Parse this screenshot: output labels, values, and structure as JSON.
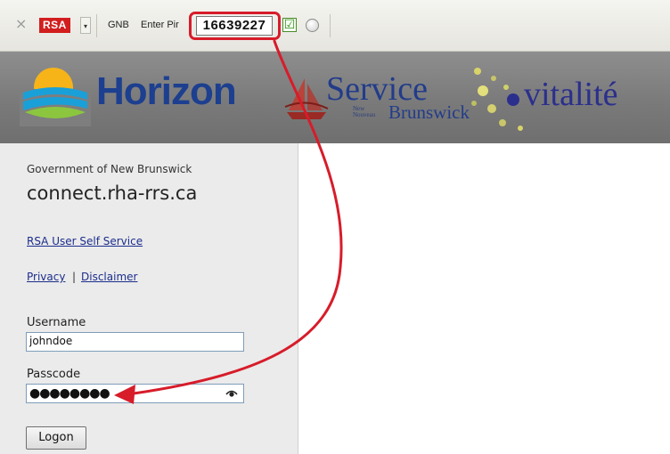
{
  "toolbar": {
    "close_glyph": "×",
    "rsa_label": "RSA",
    "dropdown_glyph": "▾",
    "gnb_label": "GNB",
    "pin_label": "Enter Pir",
    "token_code": "16639227",
    "check_glyph": "☑"
  },
  "banner": {
    "horizon_name": "Horizon",
    "service_word": "Service",
    "new_label": "New\nNouveau",
    "brunswick_word": "Brunswick",
    "vitalite_word": "vitalité"
  },
  "login": {
    "gov_label": "Government of New Brunswick",
    "site_title": "connect.rha-rrs.ca",
    "self_service_link": "RSA User Self Service",
    "privacy_link": "Privacy",
    "separator": "|",
    "disclaimer_link": "Disclaimer",
    "username_label": "Username",
    "username_value": "johndoe",
    "passcode_label": "Passcode",
    "passcode_masked": "●●●●●●●●",
    "logon_label": "Logon"
  },
  "colors": {
    "annotation_red": "#d71c2a",
    "rsa_red": "#d21e1e",
    "horizon_blue": "#1d3f8f",
    "link_blue": "#1b2d8c",
    "banner_gray": "#7e7e7e"
  },
  "icons": {
    "close": "close-icon",
    "check": "checkbox-checked-icon",
    "status": "status-circle-icon",
    "eye": "show-password-eye-icon"
  }
}
